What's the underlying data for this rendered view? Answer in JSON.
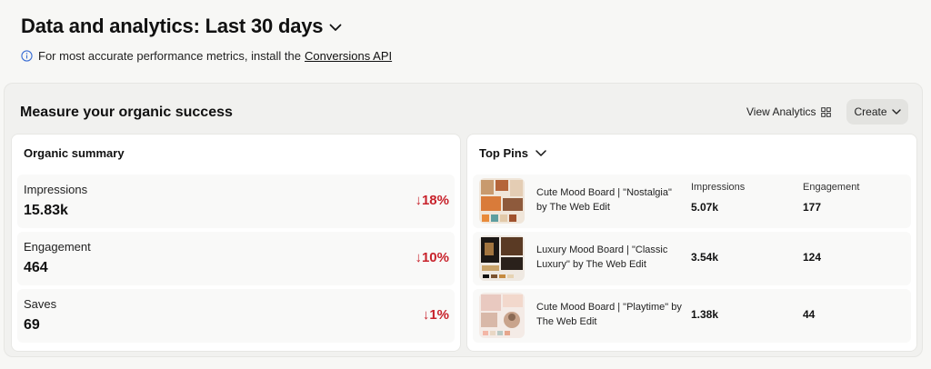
{
  "header": {
    "title": "Data and analytics: Last 30 days",
    "info_text": "For most accurate performance metrics, install the",
    "info_link": "Conversions API"
  },
  "section": {
    "title": "Measure your organic success",
    "view_analytics": "View Analytics",
    "create": "Create"
  },
  "organic_summary": {
    "title": "Organic summary",
    "metrics": [
      {
        "label": "Impressions",
        "value": "15.83k",
        "change": "↓18%"
      },
      {
        "label": "Engagement",
        "value": "464",
        "change": "↓10%"
      },
      {
        "label": "Saves",
        "value": "69",
        "change": "↓1%"
      }
    ]
  },
  "top_pins": {
    "title": "Top Pins",
    "col_impressions": "Impressions",
    "col_engagement": "Engagement",
    "pins": [
      {
        "name": "Cute Mood Board | \"Nostalgia\" by The Web Edit",
        "impressions": "5.07k",
        "engagement": "177"
      },
      {
        "name": "Luxury Mood Board | \"Classic Luxury\" by The Web Edit",
        "impressions": "3.54k",
        "engagement": "124"
      },
      {
        "name": "Cute Mood Board | \"Playtime\" by The Web Edit",
        "impressions": "1.38k",
        "engagement": "44"
      }
    ]
  },
  "colors": {
    "negative_change": "#c8232c",
    "info_icon": "#3b6fd4"
  },
  "icons": {
    "title_dropdown": "chevron-down-icon",
    "info": "info-circle-icon",
    "view_analytics": "analytics-grid-icon",
    "create_dropdown": "chevron-down-icon",
    "top_pins_dropdown": "chevron-down-icon"
  }
}
